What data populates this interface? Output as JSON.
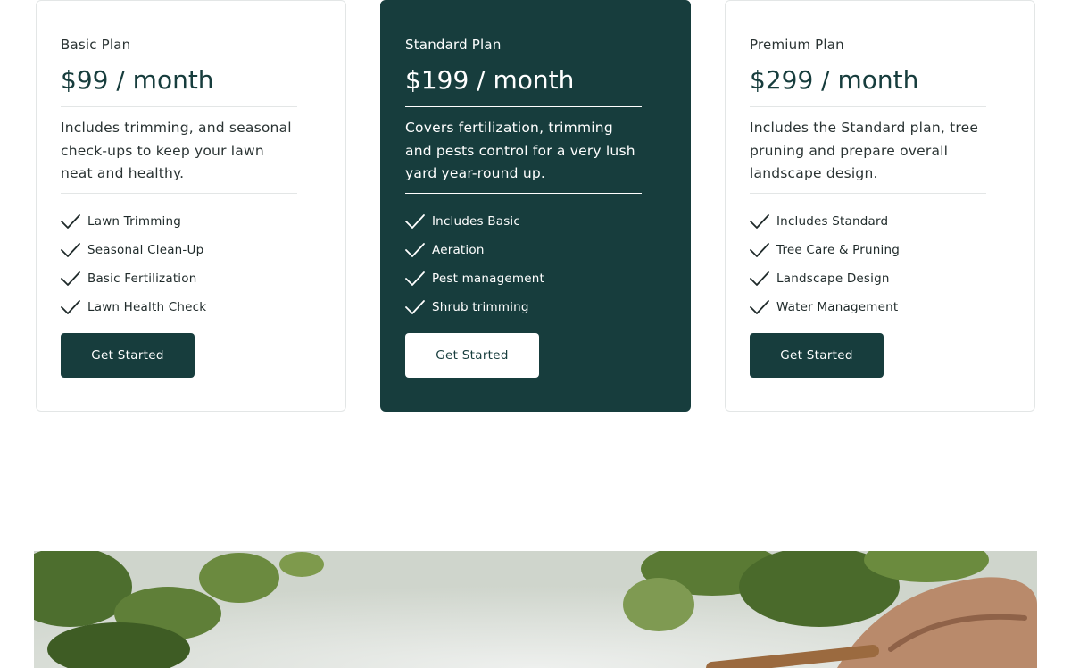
{
  "plans": [
    {
      "name": "Basic Plan",
      "price": "$99 / month",
      "description": "Includes trimming, and seasonal check-ups to keep your lawn neat and healthy.",
      "features": [
        "Lawn Trimming",
        "Seasonal Clean-Up",
        "Basic Fertilization",
        "Lawn Health Check"
      ],
      "cta": "Get Started",
      "featured": false
    },
    {
      "name": "Standard Plan",
      "price": "$199 / month",
      "description": "Covers fertilization, trimming and pests control for a very lush yard year-round up.",
      "features": [
        "Includes Basic",
        "Aeration",
        "Pest management",
        "Shrub trimming"
      ],
      "cta": "Get Started",
      "featured": true
    },
    {
      "name": "Premium Plan",
      "price": "$299 / month",
      "description": "Includes the Standard plan, tree pruning and prepare overall landscape design.",
      "features": [
        "Includes Standard",
        "Tree Care & Pruning",
        "Landscape Design",
        "Water Management"
      ],
      "cta": "Get Started",
      "featured": false
    }
  ],
  "colors": {
    "accent": "#173d3d",
    "border": "#e3e6e6",
    "background": "#ffffff"
  },
  "icons": {
    "feature_check": "check-icon"
  }
}
